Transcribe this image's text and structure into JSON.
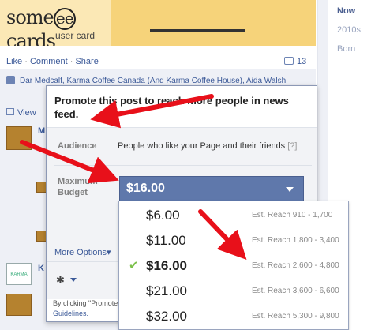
{
  "card": {
    "logo_some": "some",
    "logo_ee": "ee",
    "logo_cards": "cards",
    "subtitle": "user card"
  },
  "sidebar": {
    "items": [
      "Now",
      "2010s",
      "Born"
    ]
  },
  "post_actions": {
    "like": "Like",
    "comment": "Comment",
    "share": "Share",
    "sep": "·",
    "comment_count": "13"
  },
  "likes_text": "Dar Medcalf, Karma Coffee Canada (And Karma Coffee House), Aida Walsh",
  "view_text": "View",
  "background": {
    "name_initial": "M",
    "karma_initial": "K",
    "karma_logo": "KARMA"
  },
  "popup": {
    "title": "Promote this post to reach more people in news feed.",
    "audience_label": "Audience",
    "audience_value": "People who like your Page and their friends",
    "audience_help": "[?]",
    "budget_label": "Maximum Budget",
    "selected_budget": "$16.00",
    "more_options": "More Options",
    "more_options_caret": "▾",
    "gear_icon": "✱",
    "by_clicking": "By clicking \"Promote",
    "guidelines": "Guidelines."
  },
  "budget_options": [
    {
      "amount": "$6.00",
      "reach": "Est. Reach 910 - 1,700",
      "selected": false
    },
    {
      "amount": "$11.00",
      "reach": "Est. Reach 1,800 - 3,400",
      "selected": false
    },
    {
      "amount": "$16.00",
      "reach": "Est. Reach 2,600 - 4,800",
      "selected": true
    },
    {
      "amount": "$21.00",
      "reach": "Est. Reach 3,600 - 6,600",
      "selected": false
    },
    {
      "amount": "$32.00",
      "reach": "Est. Reach 5,300 - 9,800",
      "selected": false
    }
  ],
  "colors": {
    "accent": "#5f78ab",
    "link": "#3b5998",
    "arrow": "#e8101a",
    "check": "#7cc04b"
  }
}
